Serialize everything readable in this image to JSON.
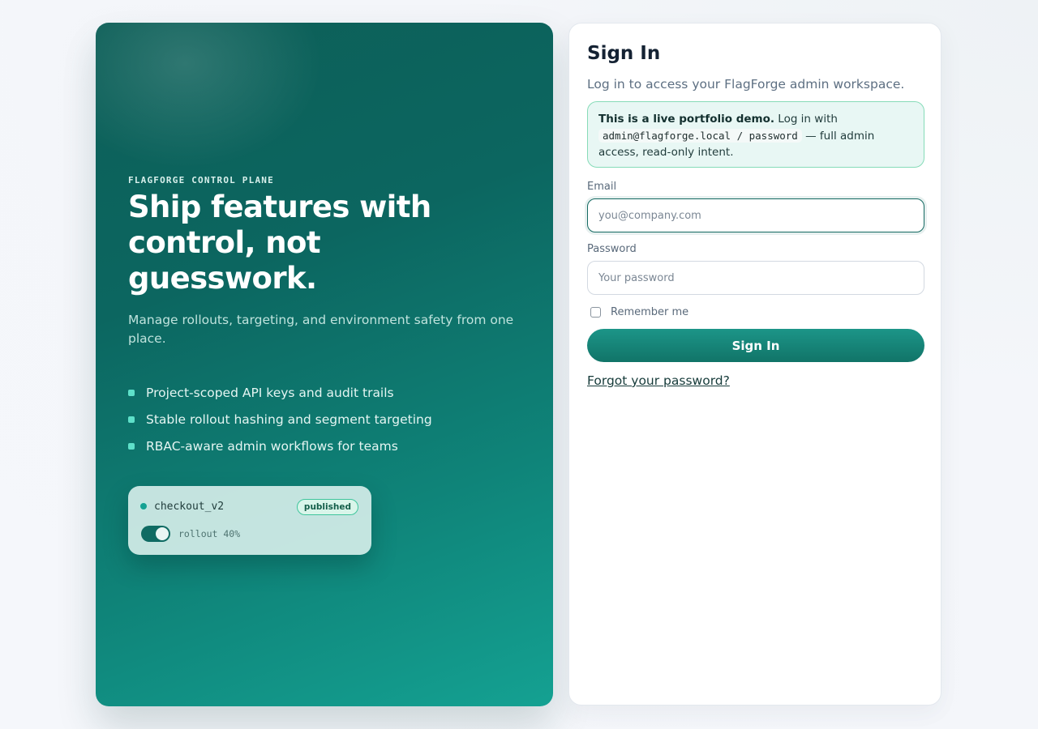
{
  "hero": {
    "eyebrow": "FLAGFORGE CONTROL PLANE",
    "headline": "Ship features with control, not guesswork.",
    "subtext": "Manage rollouts, targeting, and environment safety from one place.",
    "features": [
      "Project-scoped API keys and audit trails",
      "Stable rollout hashing and segment targeting",
      "RBAC-aware admin workflows for teams"
    ],
    "flag_card": {
      "name": "checkout_v2",
      "status": "published",
      "toggle_on": true,
      "rollout_label": "rollout 40%"
    }
  },
  "signin": {
    "title": "Sign In",
    "subtitle": "Log in to access your FlagForge admin workspace.",
    "notice": {
      "bold": "This is a live portfolio demo.",
      "text1": "Log in with",
      "credentials": "admin@flagforge.local / password",
      "text2": "— full admin access, read-only intent."
    },
    "email": {
      "label": "Email",
      "placeholder": "you@company.com",
      "value": ""
    },
    "password": {
      "label": "Password",
      "placeholder": "Your password",
      "value": ""
    },
    "remember_label": "Remember me",
    "remember_checked": false,
    "submit_label": "Sign In",
    "forgot_label": "Forgot your password?"
  },
  "colors": {
    "accent": "#117468",
    "hero_start": "#0d5f58",
    "hero_end": "#14a192",
    "notice_bg": "#e8f7f4",
    "notice_border": "#86dbb8"
  }
}
